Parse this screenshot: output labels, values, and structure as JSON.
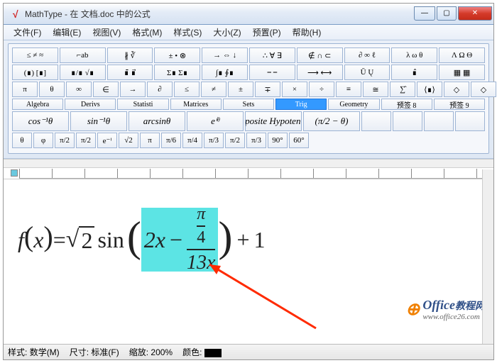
{
  "window": {
    "title": "MathType - 在 文档.doc 中的公式",
    "min": "—",
    "max": "▢",
    "close": "✕"
  },
  "menu": {
    "file": "文件(F)",
    "edit": "编辑(E)",
    "view": "视图(V)",
    "format": "格式(M)",
    "style": "样式(S)",
    "size": "大小(Z)",
    "preset": "预置(P)",
    "help": "帮助(H)"
  },
  "palette": {
    "row1": [
      "≤ ≠ ≈",
      "⌐ab",
      "∦ ∛",
      " ± • ⊗",
      "→ ⇔ ↓",
      "∴ ∀ ∃",
      "∉ ∩ ⊂",
      "∂ ∞ ℓ",
      "λ ω θ",
      "Λ Ω Θ"
    ],
    "row2": [
      "(∎) [∎]",
      "∎/∎ √∎",
      "∎̄ ∎⃗",
      "Σ∎ Σ∎",
      "∫∎ ∮∎",
      "⎯ ⎯",
      "⟶ ⟷",
      "Ū  Ų",
      "∎̂",
      "▦ ▦"
    ],
    "row3": [
      "π",
      "θ",
      "∞",
      "∈",
      "→",
      "∂",
      "≤",
      "≠",
      "±",
      "∓",
      "×",
      "÷",
      "≡",
      "≅",
      "∑̂",
      "⟨∎⟩",
      "◇",
      "◇",
      "◇",
      "◇"
    ],
    "tabs": [
      "Algebra",
      "Derivs",
      "Statisti",
      "Matrices",
      "Sets",
      "Trig",
      "Geometry",
      "预签 8",
      "预签 9"
    ],
    "big": [
      "cos⁻¹θ",
      "sin⁻¹θ",
      "arcsinθ",
      "eⁱᶿ",
      "Opposite\nHypotenuse",
      "(π/2 − θ)"
    ],
    "row5": [
      "θ",
      "φ",
      "π/2",
      "π/2",
      "e⁻ⁱ",
      "√2",
      "π",
      "π/6",
      "π/4",
      "π/3",
      "π/2",
      "π/3",
      "90°",
      "60°"
    ]
  },
  "formula": {
    "f": "f",
    "x": "x",
    "eq": "=",
    "sqrt_arg": "2",
    "sin": "sin",
    "two_x": "2x",
    "minus": "−",
    "pi": "π",
    "four": "4",
    "den": "13x",
    "plus": "+",
    "one": "1"
  },
  "status": {
    "style_lbl": "样式:",
    "style_val": "数学(M)",
    "size_lbl": "尺寸:",
    "size_val": "标准(F)",
    "zoom_lbl": "缩放:",
    "zoom_val": "200%",
    "color_lbl": "颜色:"
  },
  "watermark": {
    "brand": "Office",
    "sub": "教程网",
    "url": "www.office26.com"
  }
}
